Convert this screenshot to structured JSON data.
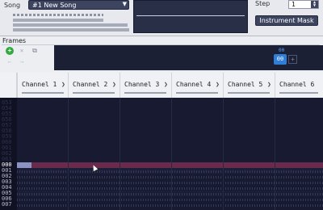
{
  "toolbar": {
    "song_label": "Song",
    "song_value": "#1 New Song",
    "step_label": "Step",
    "step_value": "1",
    "instrument_mask_label": "Instrument Mask",
    "arrow_down": "▼",
    "spin_up": "▲",
    "spin_down": "▼"
  },
  "frames": {
    "title": "Frames",
    "add_icon": "+",
    "remove_icon": "✕",
    "duplicate_icon": "⧉",
    "prev_icon": "←",
    "next_icon": "→",
    "column_header": "00",
    "frame_value": "00",
    "add_cell_label": "+"
  },
  "channels": [
    {
      "name": "Channel 1",
      "arrow": "❯"
    },
    {
      "name": "Channel 2",
      "arrow": "❯"
    },
    {
      "name": "Channel 3",
      "arrow": "❯"
    },
    {
      "name": "Channel 4",
      "arrow": "❯"
    },
    {
      "name": "Channel 5",
      "arrow": "❯"
    },
    {
      "name": "Channel 6",
      "arrow": "❯"
    }
  ],
  "rows": {
    "above": [
      "053",
      "054",
      "055",
      "056",
      "057",
      "058",
      "059",
      "060",
      "061",
      "062",
      "063"
    ],
    "current": "000",
    "below": [
      "001",
      "002",
      "003",
      "004",
      "005",
      "006",
      "007"
    ]
  },
  "colors": {
    "cursor_row": "#6a2a4c",
    "frame_selected": "#2f7fd8",
    "add_green": "#2eab3c"
  }
}
